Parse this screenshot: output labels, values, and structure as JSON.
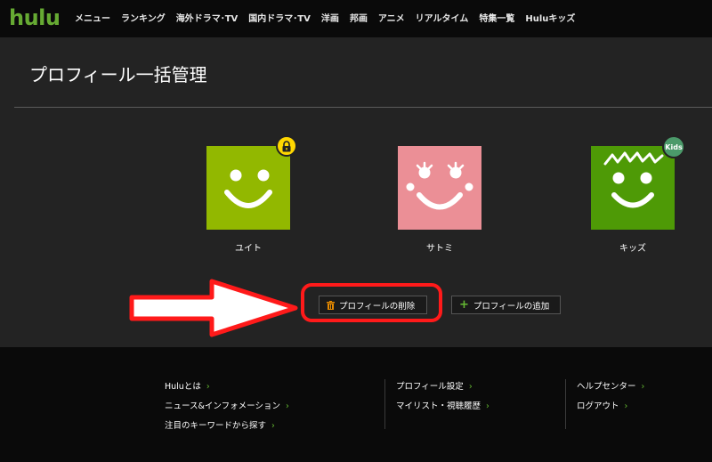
{
  "header": {
    "logo": "hulu",
    "nav": [
      "メニュー",
      "ランキング",
      "海外ドラマ･TV",
      "国内ドラマ･TV",
      "洋画",
      "邦画",
      "アニメ",
      "リアルタイム",
      "特集一覧",
      "Huluキッズ"
    ]
  },
  "main": {
    "title": "プロフィール一括管理",
    "profiles": [
      {
        "name": "ユイト",
        "color": "#92b800",
        "badge": "lock"
      },
      {
        "name": "サトミ",
        "color": "#eb8f96",
        "badge": ""
      },
      {
        "name": "キッズ",
        "color": "#4e9a06",
        "badge": "Kids"
      }
    ],
    "buttons": {
      "delete_label": "プロフィールの削除",
      "add_label": "プロフィールの追加"
    }
  },
  "footer": {
    "col1": [
      "Huluとは",
      "ニュース&インフォメーション",
      "注目のキーワードから探す"
    ],
    "col2": [
      "プロフィール設定",
      "マイリスト・視聴履歴"
    ],
    "col3": [
      "ヘルプセンター",
      "ログアウト"
    ],
    "chevron": "›"
  },
  "colors": {
    "brand": "#66aa33",
    "highlight": "#ff1a1a"
  }
}
